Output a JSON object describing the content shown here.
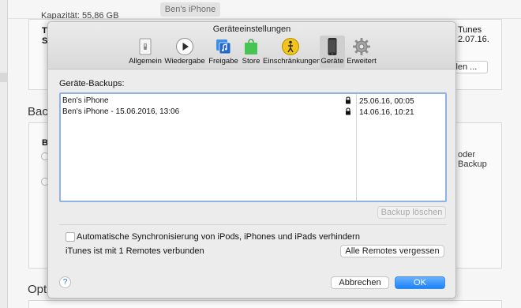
{
  "background": {
    "device_name": "Ben's iPhone",
    "capacity_label": "Kapazität: 55,86 GB",
    "left_label_fragment_1": "T",
    "left_label_fragment_2": "S",
    "right_text_1": "Tunes",
    "right_text_2": "2.07.16.",
    "right_button_fragment": "llen ...",
    "backup_heading_fragment": "Back",
    "options_heading_fragment": "Opti",
    "right_text_3": "oder",
    "right_text_4": "Backup",
    "left_radio_label_fragment": "B"
  },
  "dialog": {
    "title": "Geräteeinstellungen",
    "toolbar": [
      {
        "label": "Allgemein",
        "icon": "general-switch-icon",
        "selected": false
      },
      {
        "label": "Wiedergabe",
        "icon": "play-icon",
        "selected": false
      },
      {
        "label": "Freigabe",
        "icon": "sharing-icon",
        "selected": false
      },
      {
        "label": "Store",
        "icon": "store-bag-icon",
        "selected": false
      },
      {
        "label": "Einschränkungen",
        "icon": "parental-controls-icon",
        "selected": false
      },
      {
        "label": "Geräte",
        "icon": "iphone-icon",
        "selected": true
      },
      {
        "label": "Erweitert",
        "icon": "gear-icon",
        "selected": false
      }
    ],
    "backups_label": "Geräte-Backups:",
    "backups": [
      {
        "name": "Ben's iPhone",
        "date": "25.06.16, 00:05",
        "locked": true
      },
      {
        "name": "Ben's iPhone - 15.06.2016, 13:06",
        "date": "14.06.16, 10:21",
        "locked": true
      }
    ],
    "delete_backup_label": "Backup löschen",
    "prevent_sync_label": "Automatische Synchronisierung von iPods, iPhones und iPads verhindern",
    "prevent_sync_checked": false,
    "remotes_text": "iTunes ist mit 1 Remotes verbunden",
    "forget_remotes_label": "Alle Remotes vergessen",
    "help_label": "?",
    "cancel_label": "Abbrechen",
    "ok_label": "OK",
    "accent_color": "#1a82fb"
  }
}
